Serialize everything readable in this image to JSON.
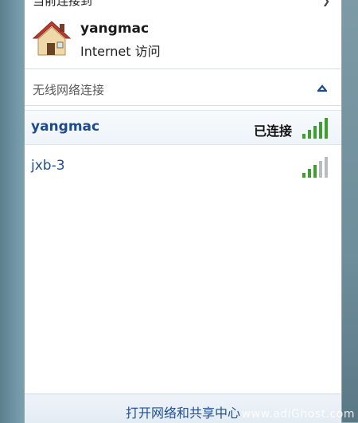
{
  "panel": {
    "current_header": "当前连接到",
    "connected": {
      "name": "yangmac",
      "access": "Internet 访问",
      "icon": "house-icon"
    },
    "section": {
      "label": "无线网络连接",
      "toggle_icon": "chevron-up-icon"
    },
    "networks": [
      {
        "name": "yangmac",
        "status": "已连接",
        "signal_bars": 5,
        "signal_icon": "wifi-signal-icon"
      },
      {
        "name": "jxb-3",
        "status": "",
        "signal_bars": 3,
        "signal_icon": "wifi-signal-icon"
      }
    ],
    "footer_link": "打开网络和共享中心"
  },
  "watermark": "www.adiGhost.com",
  "colors": {
    "link": "#1f4f96",
    "signal_active": "#3f9e2f",
    "signal_inactive": "#b7bcbf"
  }
}
